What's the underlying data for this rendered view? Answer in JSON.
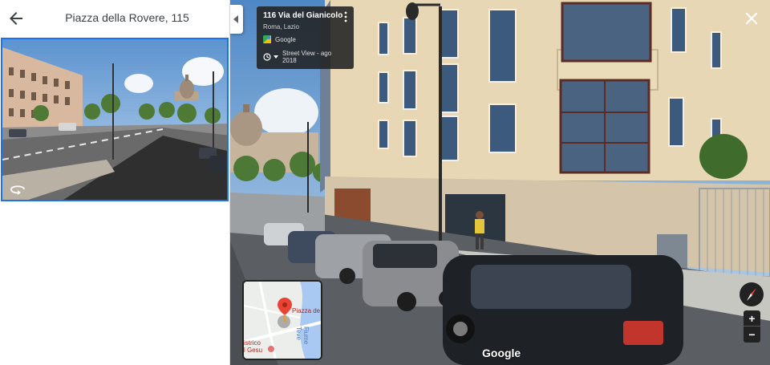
{
  "left_panel": {
    "title": "Piazza della Rovere, 115"
  },
  "info_card": {
    "address": "116 Via del Gianicolo",
    "locality": "Roma, Lazio",
    "provider": "Google",
    "capture": "Street View - ago 2018"
  },
  "minimap": {
    "label_place": "Piazza de",
    "label_river": "Fiume Teve",
    "label_church": "istrico\nl Gesu"
  },
  "zoom": {
    "in_label": "+",
    "out_label": "−"
  },
  "brand": {
    "logo_text": "Google"
  },
  "colors": {
    "accent_blue": "#1a73e8",
    "overlay_dark": "#222222",
    "pin_red": "#ea4335"
  },
  "icons": {
    "back": "arrow-left-icon",
    "close": "close-icon",
    "more": "more-vert-icon",
    "history": "clock-history-icon",
    "rotate": "rotate-icon",
    "compass": "compass-icon",
    "pin": "map-pin-icon",
    "collapse": "chevron-left-icon"
  }
}
